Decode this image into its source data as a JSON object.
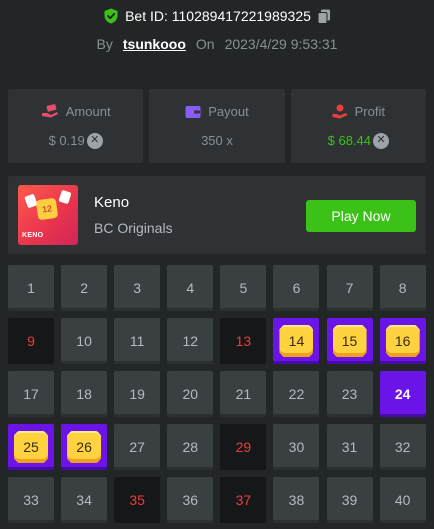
{
  "header": {
    "bet_id": "Bet ID: 110289417221989325",
    "by_label": "By",
    "username": "tsunkooo",
    "on_label": "On",
    "date": "2023/4/29 9:53:31"
  },
  "stats": {
    "amount": {
      "label": "Amount",
      "value": "$ 0.19"
    },
    "payout": {
      "label": "Payout",
      "value": "350 x"
    },
    "profit": {
      "label": "Profit",
      "value": "$ 68.44"
    },
    "colors": {
      "amount_icon": "#e94d6e",
      "payout_icon": "#8a5cf6",
      "profit_icon": "#ec3d3d",
      "profit_value": "#3bc117"
    }
  },
  "game": {
    "name": "Keno",
    "provider": "BC Originals",
    "play_label": "Play Now",
    "thumb_number": "12",
    "thumb_logo": "KENO"
  },
  "board": {
    "cells": [
      {
        "n": "1",
        "state": "normal"
      },
      {
        "n": "2",
        "state": "normal"
      },
      {
        "n": "3",
        "state": "normal"
      },
      {
        "n": "4",
        "state": "normal"
      },
      {
        "n": "5",
        "state": "normal"
      },
      {
        "n": "6",
        "state": "normal"
      },
      {
        "n": "7",
        "state": "normal"
      },
      {
        "n": "8",
        "state": "normal"
      },
      {
        "n": "9",
        "state": "miss"
      },
      {
        "n": "10",
        "state": "normal"
      },
      {
        "n": "11",
        "state": "normal"
      },
      {
        "n": "12",
        "state": "normal"
      },
      {
        "n": "13",
        "state": "miss"
      },
      {
        "n": "14",
        "state": "hit"
      },
      {
        "n": "15",
        "state": "hit"
      },
      {
        "n": "16",
        "state": "hit"
      },
      {
        "n": "17",
        "state": "normal"
      },
      {
        "n": "18",
        "state": "normal"
      },
      {
        "n": "19",
        "state": "normal"
      },
      {
        "n": "20",
        "state": "normal"
      },
      {
        "n": "21",
        "state": "normal"
      },
      {
        "n": "22",
        "state": "normal"
      },
      {
        "n": "23",
        "state": "normal"
      },
      {
        "n": "24",
        "state": "selected"
      },
      {
        "n": "25",
        "state": "hit"
      },
      {
        "n": "26",
        "state": "hit"
      },
      {
        "n": "27",
        "state": "normal"
      },
      {
        "n": "28",
        "state": "normal"
      },
      {
        "n": "29",
        "state": "miss"
      },
      {
        "n": "30",
        "state": "normal"
      },
      {
        "n": "31",
        "state": "normal"
      },
      {
        "n": "32",
        "state": "normal"
      },
      {
        "n": "33",
        "state": "normal"
      },
      {
        "n": "34",
        "state": "normal"
      },
      {
        "n": "35",
        "state": "miss"
      },
      {
        "n": "36",
        "state": "normal"
      },
      {
        "n": "37",
        "state": "miss"
      },
      {
        "n": "38",
        "state": "normal"
      },
      {
        "n": "39",
        "state": "normal"
      },
      {
        "n": "40",
        "state": "normal"
      }
    ]
  }
}
